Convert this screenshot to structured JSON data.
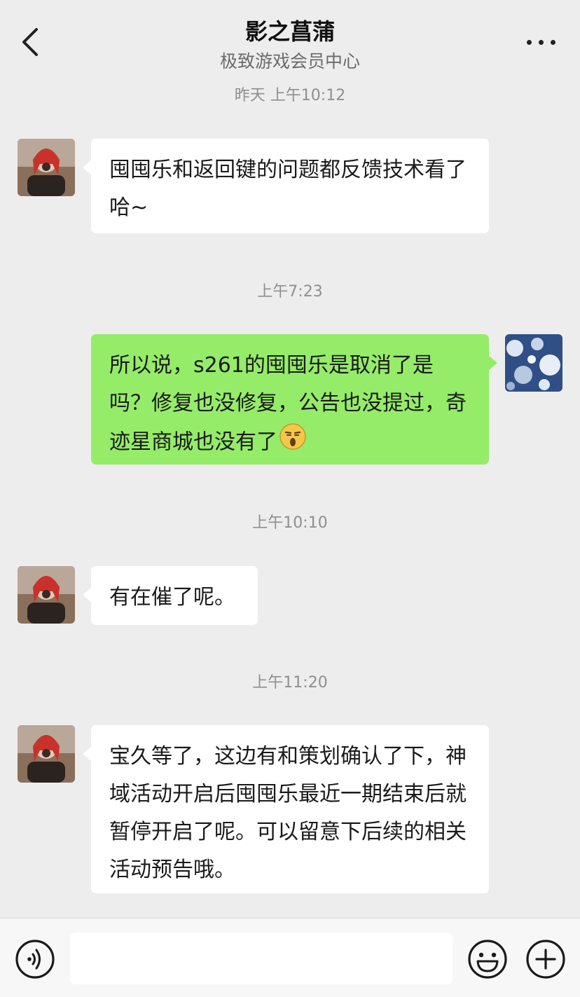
{
  "header": {
    "title": "影之菖蒲",
    "subtitle": "极致游戏会员中心"
  },
  "messages": [
    {
      "timestamp": "昨天 上午10:12",
      "sender": "service",
      "text": "囤囤乐和返回键的问题都反馈技术看了哈~"
    },
    {
      "timestamp": "上午7:23",
      "sender": "me",
      "text": "所以说，s261的囤囤乐是取消了是吗？修复也没修复，公告也没提过，奇迹星商城也没有了",
      "emoji": "shocked-face-emoji"
    },
    {
      "timestamp": "上午10:10",
      "sender": "service",
      "text": "有在催了呢。"
    },
    {
      "timestamp": "上午11:20",
      "sender": "service",
      "text": "宝久等了，这边有和策划确认了下，神域活动开启后囤囤乐最近一期结束后就暂停开启了呢。可以留意下后续的相关活动预告哦。"
    }
  ],
  "bottom_bar": {
    "voice_icon": "voice-icon",
    "emoji_icon": "emoji-icon",
    "plus_icon": "plus-icon"
  },
  "colors": {
    "background": "#ededed",
    "incoming_bubble": "#ffffff",
    "outgoing_bubble": "#95ec69"
  }
}
